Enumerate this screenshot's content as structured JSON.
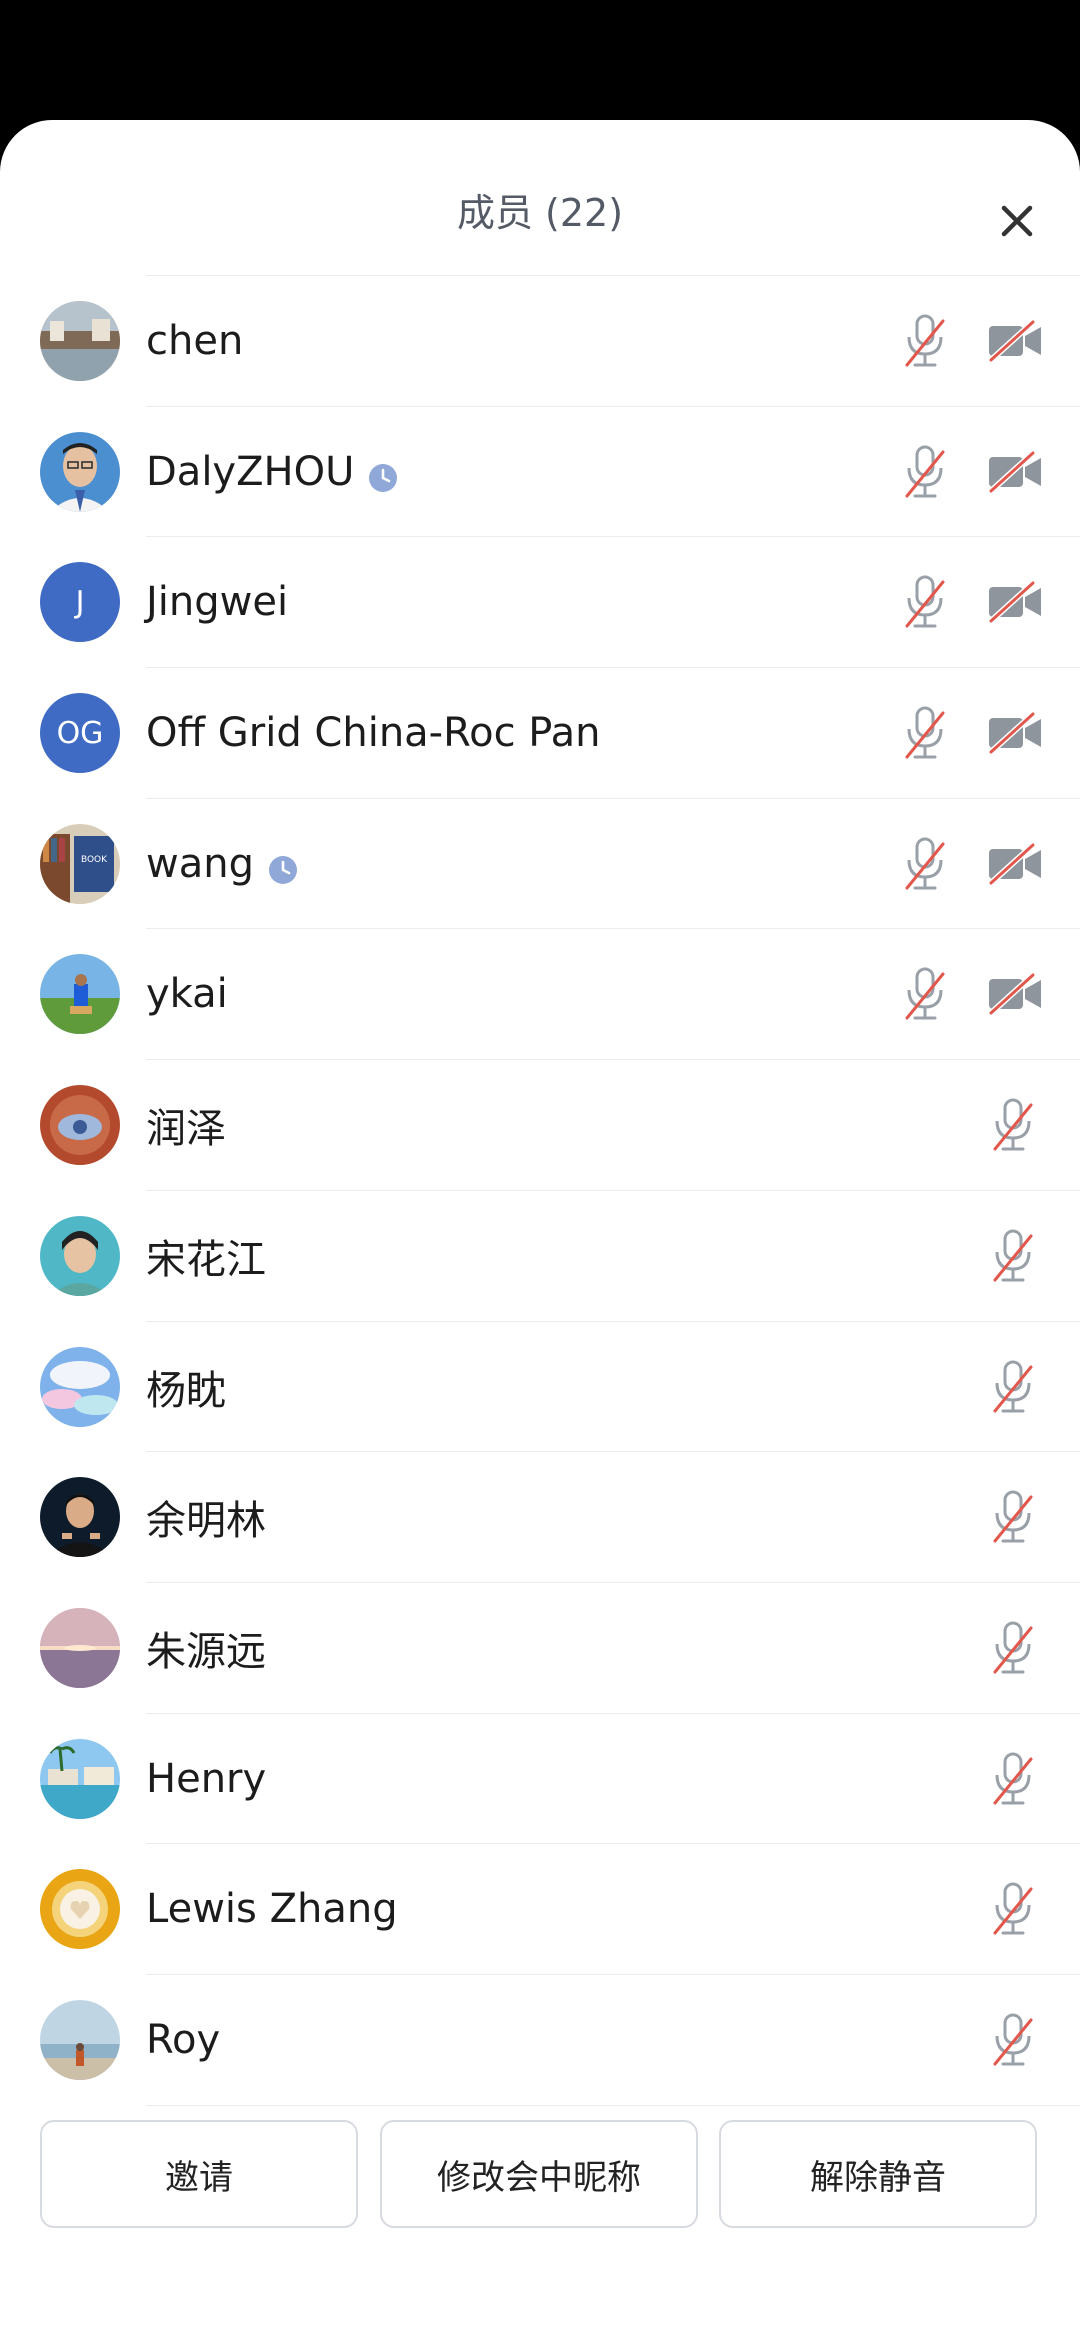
{
  "header": {
    "title": "成员 (22)"
  },
  "members": [
    {
      "name": "chen",
      "avatar": "photo-canal",
      "status_icon": "",
      "mic": "muted",
      "camera": "off"
    },
    {
      "name": "DalyZHOU",
      "avatar": "photo-man-glasses",
      "status_icon": "clock-icon",
      "mic": "muted",
      "camera": "off"
    },
    {
      "name": "Jingwei",
      "avatar": "letter",
      "initials": "J",
      "status_icon": "",
      "mic": "muted",
      "camera": "off"
    },
    {
      "name": "Off Grid China-Roc Pan",
      "avatar": "letter",
      "initials": "OG",
      "status_icon": "",
      "mic": "muted",
      "camera": "off"
    },
    {
      "name": "wang",
      "avatar": "photo-books",
      "status_icon": "clock-icon",
      "mic": "muted",
      "camera": "off"
    },
    {
      "name": "ykai",
      "avatar": "photo-field",
      "status_icon": "",
      "mic": "muted",
      "camera": "off"
    },
    {
      "name": "润泽",
      "avatar": "photo-red-eye",
      "status_icon": "",
      "mic": "muted",
      "camera": ""
    },
    {
      "name": "宋花江",
      "avatar": "photo-woman",
      "status_icon": "",
      "mic": "muted",
      "camera": ""
    },
    {
      "name": "杨眈",
      "avatar": "photo-clouds",
      "status_icon": "",
      "mic": "muted",
      "camera": ""
    },
    {
      "name": "余明林",
      "avatar": "photo-speaker",
      "status_icon": "",
      "mic": "muted",
      "camera": ""
    },
    {
      "name": "朱源远",
      "avatar": "photo-sunset",
      "status_icon": "",
      "mic": "muted",
      "camera": ""
    },
    {
      "name": "Henry",
      "avatar": "photo-resort",
      "status_icon": "",
      "mic": "muted",
      "camera": ""
    },
    {
      "name": "Lewis Zhang",
      "avatar": "photo-coffee",
      "status_icon": "",
      "mic": "muted",
      "camera": ""
    },
    {
      "name": "Roy",
      "avatar": "photo-beach",
      "status_icon": "",
      "mic": "muted",
      "camera": ""
    }
  ],
  "footer": {
    "invite_label": "邀请",
    "rename_label": "修改会中昵称",
    "unmute_label": "解除静音"
  },
  "colors": {
    "accent_letter_avatar": "#3f6bc4",
    "muted_slash": "#e2574c",
    "icon_gray": "#9aa0a8",
    "clock_blue": "#8fa8d8"
  }
}
